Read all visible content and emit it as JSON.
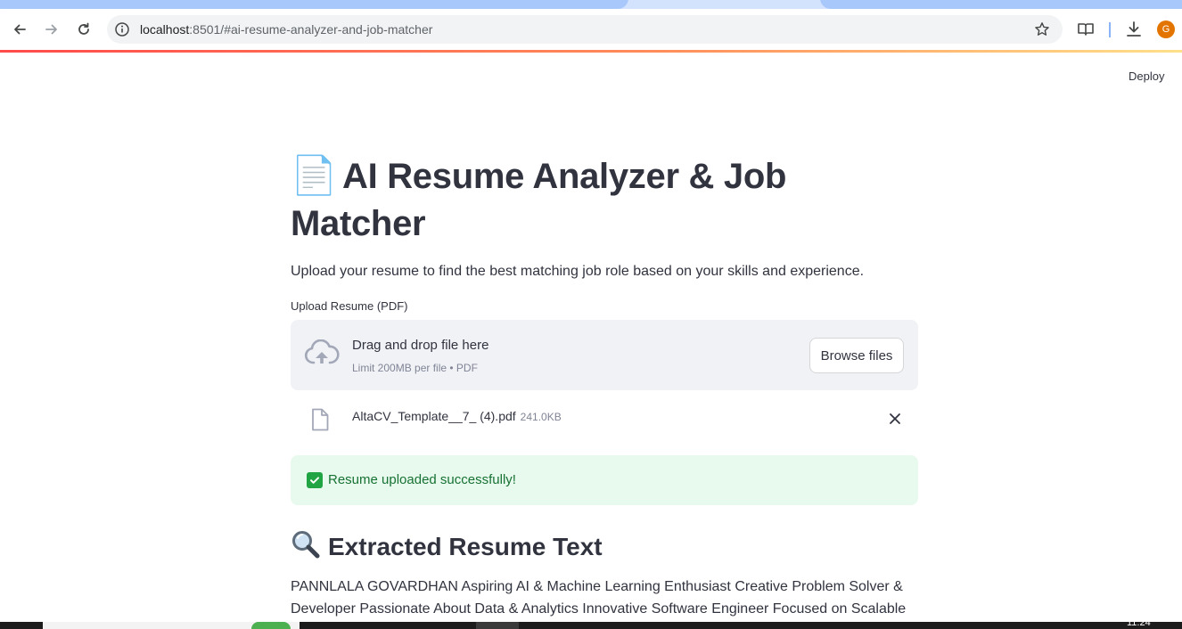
{
  "browser": {
    "url_host": "localhost",
    "url_rest": ":8501/#ai-resume-analyzer-and-job-matcher",
    "profile_initial": "G",
    "icons": {
      "back": "back-arrow-icon",
      "forward": "forward-arrow-icon",
      "reload": "reload-icon",
      "site_info": "site-info-icon",
      "bookmark": "star-icon",
      "reading_mode": "reading-mode-icon",
      "downloads": "download-icon"
    }
  },
  "app": {
    "deploy_label": "Deploy",
    "title_emoji": "📄",
    "title": "AI Resume Analyzer & Job Matcher",
    "subtitle": "Upload your resume to find the best matching job role based on your skills and experience.",
    "uploader": {
      "label": "Upload Resume (PDF)",
      "drag_text": "Drag and drop file here",
      "limit_text": "Limit 200MB per file • PDF",
      "browse_label": "Browse files"
    },
    "uploaded_file": {
      "name": "AltaCV_Template__7_ (4).pdf",
      "size": "241.0KB"
    },
    "success_message": "Resume uploaded successfully!",
    "extracted_heading": "Extracted Resume Text",
    "extracted_text": "PANNLALA GOVARDHAN Aspiring AI & Machine Learning Enthusiast Creative Problem Solver & Developer Passionate About Data & Analytics Innovative Software Engineer Focused on Scalable Solutions \\csuse"
  },
  "taskbar": {
    "clock": "11:24"
  },
  "colors": {
    "text": "#31333f",
    "dropzone_bg": "#f0f2f6",
    "success_bg": "#e8f9ee",
    "success_text": "#177233",
    "accent_gradient_start": "#ff4b4b",
    "accent_gradient_end": "#ffe08a"
  }
}
